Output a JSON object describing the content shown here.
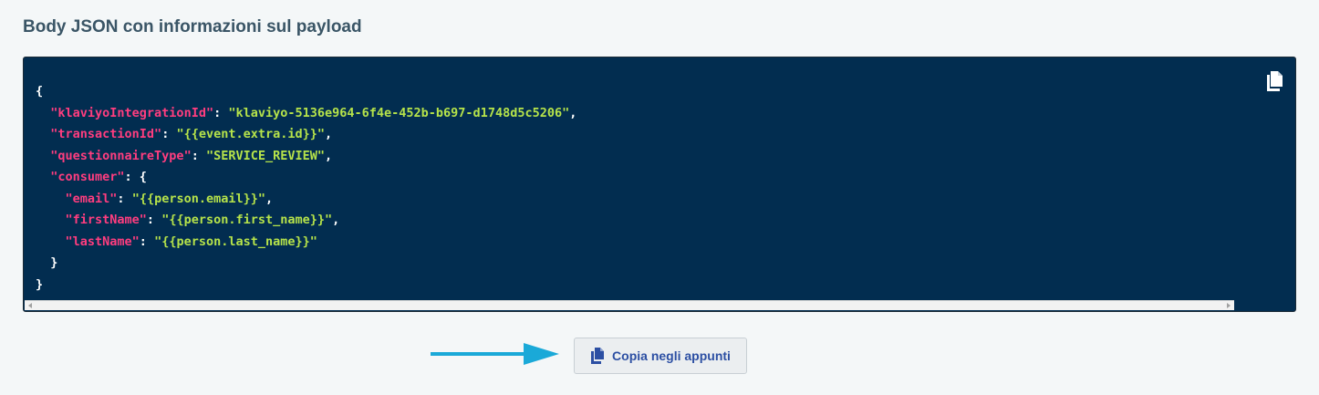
{
  "page": {
    "title": "Body JSON con informazioni sul payload"
  },
  "code_block": {
    "lines": [
      [
        {
          "t": "p",
          "v": "{"
        }
      ],
      [
        {
          "t": "p",
          "v": "  "
        },
        {
          "t": "k",
          "v": "\"klaviyoIntegrationId\""
        },
        {
          "t": "p",
          "v": ": "
        },
        {
          "t": "s",
          "v": "\"klaviyo-5136e964-6f4e-452b-b697-d1748d5c5206\""
        },
        {
          "t": "p",
          "v": ","
        }
      ],
      [
        {
          "t": "p",
          "v": "  "
        },
        {
          "t": "k",
          "v": "\"transactionId\""
        },
        {
          "t": "p",
          "v": ": "
        },
        {
          "t": "s",
          "v": "\"{{event.extra.id}}\""
        },
        {
          "t": "p",
          "v": ","
        }
      ],
      [
        {
          "t": "p",
          "v": "  "
        },
        {
          "t": "k",
          "v": "\"questionnaireType\""
        },
        {
          "t": "p",
          "v": ": "
        },
        {
          "t": "s",
          "v": "\"SERVICE_REVIEW\""
        },
        {
          "t": "p",
          "v": ","
        }
      ],
      [
        {
          "t": "p",
          "v": "  "
        },
        {
          "t": "k",
          "v": "\"consumer\""
        },
        {
          "t": "p",
          "v": ": {"
        }
      ],
      [
        {
          "t": "p",
          "v": "    "
        },
        {
          "t": "k",
          "v": "\"email\""
        },
        {
          "t": "p",
          "v": ": "
        },
        {
          "t": "s",
          "v": "\"{{person.email}}\""
        },
        {
          "t": "p",
          "v": ","
        }
      ],
      [
        {
          "t": "p",
          "v": "    "
        },
        {
          "t": "k",
          "v": "\"firstName\""
        },
        {
          "t": "p",
          "v": ": "
        },
        {
          "t": "s",
          "v": "\"{{person.first_name}}\""
        },
        {
          "t": "p",
          "v": ","
        }
      ],
      [
        {
          "t": "p",
          "v": "    "
        },
        {
          "t": "k",
          "v": "\"lastName\""
        },
        {
          "t": "p",
          "v": ": "
        },
        {
          "t": "s",
          "v": "\"{{person.last_name}}\""
        }
      ],
      [
        {
          "t": "p",
          "v": "  }"
        }
      ],
      [
        {
          "t": "p",
          "v": "}"
        }
      ]
    ],
    "copy_icon": "copy-icon"
  },
  "copy_button": {
    "label": "Copia negli appunti",
    "icon": "copy-icon"
  },
  "colors": {
    "code_background": "#022d50",
    "json_key": "#ff3d7f",
    "json_string": "#b6e34a",
    "json_punctuation": "#ffffff",
    "arrow": "#1aa9d8",
    "button_text": "#2c4fa3"
  }
}
